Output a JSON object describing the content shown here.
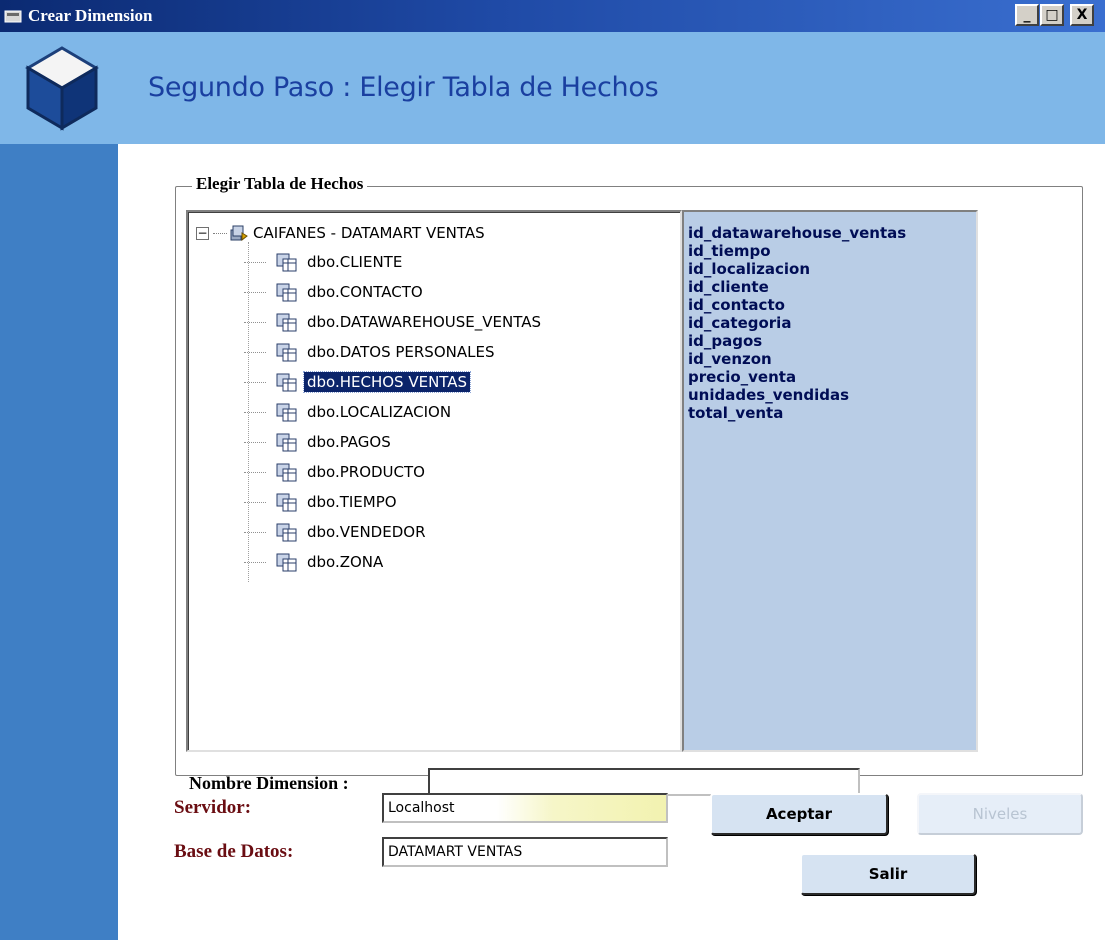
{
  "window": {
    "title": "Crear Dimension",
    "min_glyph": "_",
    "max_glyph": "□",
    "close_glyph": "X"
  },
  "header": {
    "title": "Segundo Paso : Elegir Tabla de Hechos"
  },
  "group": {
    "legend": "Elegir Tabla de Hechos"
  },
  "tree": {
    "root_label": "CAIFANES - DATAMART VENTAS",
    "expander_glyph": "−",
    "items": [
      {
        "label": "dbo.CLIENTE",
        "selected": false
      },
      {
        "label": "dbo.CONTACTO",
        "selected": false
      },
      {
        "label": "dbo.DATAWAREHOUSE_VENTAS",
        "selected": false
      },
      {
        "label": "dbo.DATOS PERSONALES",
        "selected": false
      },
      {
        "label": "dbo.HECHOS VENTAS",
        "selected": true
      },
      {
        "label": "dbo.LOCALIZACION",
        "selected": false
      },
      {
        "label": "dbo.PAGOS",
        "selected": false
      },
      {
        "label": "dbo.PRODUCTO",
        "selected": false
      },
      {
        "label": "dbo.TIEMPO",
        "selected": false
      },
      {
        "label": "dbo.VENDEDOR",
        "selected": false
      },
      {
        "label": "dbo.ZONA",
        "selected": false
      }
    ]
  },
  "columns": [
    "id_datawarehouse_ventas",
    "id_tiempo",
    "id_localizacion",
    "id_cliente",
    "id_contacto",
    "id_categoria",
    "id_pagos",
    "id_venzon",
    "precio_venta",
    "unidades_vendidas",
    "total_venta"
  ],
  "form": {
    "nombre_label": "Nombre Dimension :",
    "nombre_value": "",
    "servidor_label": "Servidor:",
    "servidor_value": "Localhost",
    "base_label": "Base de Datos:",
    "base_value": "DATAMART VENTAS"
  },
  "buttons": {
    "aceptar": "Aceptar",
    "niveles": "Niveles",
    "salir": "Salir"
  },
  "colors": {
    "header_band": "#7fb7e8",
    "side_band": "#3f7fc5",
    "selection": "#0b246a",
    "columns_bg": "#b9cde6",
    "label_dark_red": "#6a0d12"
  }
}
